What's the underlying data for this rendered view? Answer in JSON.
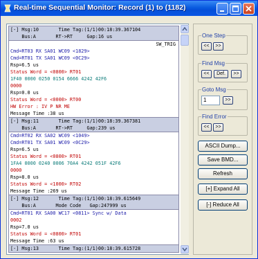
{
  "window": {
    "title": "Real-time Sequential Monitor: Record (1) to (1182)"
  },
  "records": [
    {
      "header": [
        "[-] Msg:10       Time Tag:(1/1)00:18:39.367104",
        "    Bus:A       RT->RT     Gap:16 us"
      ],
      "lines": [
        {
          "text": "SW_TRIG",
          "color": "black",
          "align": "right"
        },
        {
          "text": "Cmd=RT03 RX SA01 WC09 <1829>",
          "color": "blue"
        },
        {
          "text": "Cmd=RT01 TX SA01 WC09 <0C29>",
          "color": "blue"
        },
        {
          "text": "Rsp=6.5 us",
          "color": "black"
        },
        {
          "text": "Status Word = <0800> RT01",
          "color": "red"
        },
        {
          "text": "1F40 0000 0250 0154 6666 4242 42F6",
          "color": "teal"
        },
        {
          "text": "0000",
          "color": "red"
        },
        {
          "text": "Rsp=0.0 us",
          "color": "black"
        },
        {
          "text": "Status Word = <0000> RT00",
          "color": "red"
        },
        {
          "text": "HW Error : IV P NR ME",
          "color": "red"
        },
        {
          "text": "Message Time :38 us",
          "color": "black"
        }
      ]
    },
    {
      "header": [
        "[-] Msg:11       Time Tag:(1/1)00:18:39.367381",
        "    Bus:A       RT->RT     Gap:239 us"
      ],
      "lines": [
        {
          "text": "Cmd=RT02 RX SA02 WC09 <1049>",
          "color": "blue"
        },
        {
          "text": "Cmd=RT01 TX SA01 WC09 <0C29>",
          "color": "blue"
        },
        {
          "text": "Rsp=6.5 us",
          "color": "black"
        },
        {
          "text": "Status Word = <0800> RT01",
          "color": "red"
        },
        {
          "text": "1FA4 0000 0240 0006 70A4 4242 051F 42F6",
          "color": "teal"
        },
        {
          "text": "0000",
          "color": "red"
        },
        {
          "text": "Rsp=8.0 us",
          "color": "black"
        },
        {
          "text": "Status Word = <1000> RT02",
          "color": "red"
        },
        {
          "text": "Message Time :269 us",
          "color": "black"
        }
      ]
    },
    {
      "header": [
        "[-] Msg:12       Time Tag:(1/1)00:18:39.615649",
        "    Bus:A       Mode Code   Gap:247999 us"
      ],
      "lines": [
        {
          "text": "Cmd=RT01 RX SA00 WC17 <0811> Sync w/ Data",
          "color": "blue"
        },
        {
          "text": "0002",
          "color": "red"
        },
        {
          "text": "Rsp=7.0 us",
          "color": "black"
        },
        {
          "text": "Status Word = <0800> RT01",
          "color": "red"
        },
        {
          "text": "Message Time :63 us",
          "color": "black"
        }
      ]
    },
    {
      "header": [
        "[-] Msg:13       Time Tag:(1/1)00:18:39.615728"
      ],
      "lines": []
    }
  ],
  "controls": {
    "one_step": {
      "label": "One Step",
      "prev": "<<",
      "next": ">>"
    },
    "find_msg": {
      "label": "Find Msg",
      "prev": "<<",
      "def": "Def.",
      "next": ">>"
    },
    "goto_msg": {
      "label": "Goto Msg",
      "value": "1",
      "go": ">>"
    },
    "find_error": {
      "label": "Find Error",
      "prev": "<<",
      "next": ">>"
    },
    "ascii_dump": "ASCII Dump...",
    "save_bmd": "Save BMD...",
    "refresh": "Refresh",
    "expand_all": "[+] Expand All",
    "reduce_all": "[-] Reduce All"
  },
  "colors": {
    "titlebar": "#0a5be0",
    "command": "#1a1aa8",
    "status": "#c00000",
    "data": "#0a7a78",
    "record_header": "#c9cfe2"
  }
}
